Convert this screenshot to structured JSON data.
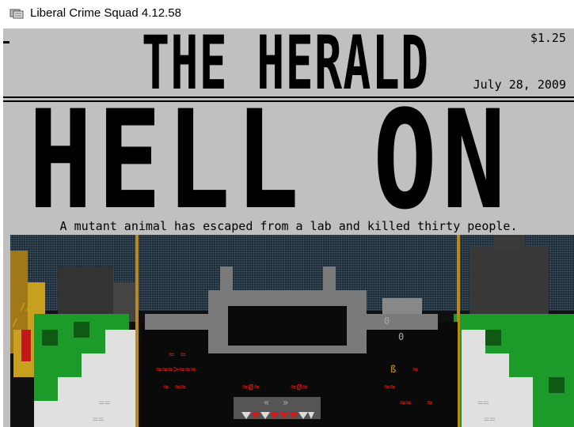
{
  "window": {
    "title": "Liberal Crime Squad 4.12.58",
    "app_icon": "lcs-app-icon"
  },
  "newspaper": {
    "masthead": "THE HERALD",
    "price": "$1.25",
    "date": "July 28, 2009",
    "headline": "HELL ON EARTH",
    "subheadline": "A mutant animal has escaped from a lab and killed thirty people."
  },
  "scene": {
    "description_tags": [
      "mutant-animal-illustration"
    ],
    "colors": {
      "background": "#c0c0c0",
      "sky": "#1e2a35",
      "grass": "#1c9a2a",
      "beast": "#7a7a7a",
      "blood": "#d11a1a",
      "pole": "#b88a1c"
    },
    "glyphs": {
      "g1": "≈ ≈",
      "g2": "≈≈≈>≈≈≈",
      "g3": "≈ ≈≈",
      "g4": "≈ø≈",
      "g5": "≈ø≈",
      "g6": "ß",
      "g7": "≈",
      "g8": "≈≈",
      "g9": "≈≈",
      "g10": "≈",
      "g11": "@@",
      "g12": "«",
      "g13": "»",
      "g14": "0",
      "g15": "0",
      "g16": "//",
      "g17": "//",
      "g18": "/",
      "g19": "==",
      "g20": "==",
      "g21": "==",
      "g22": "=="
    }
  }
}
